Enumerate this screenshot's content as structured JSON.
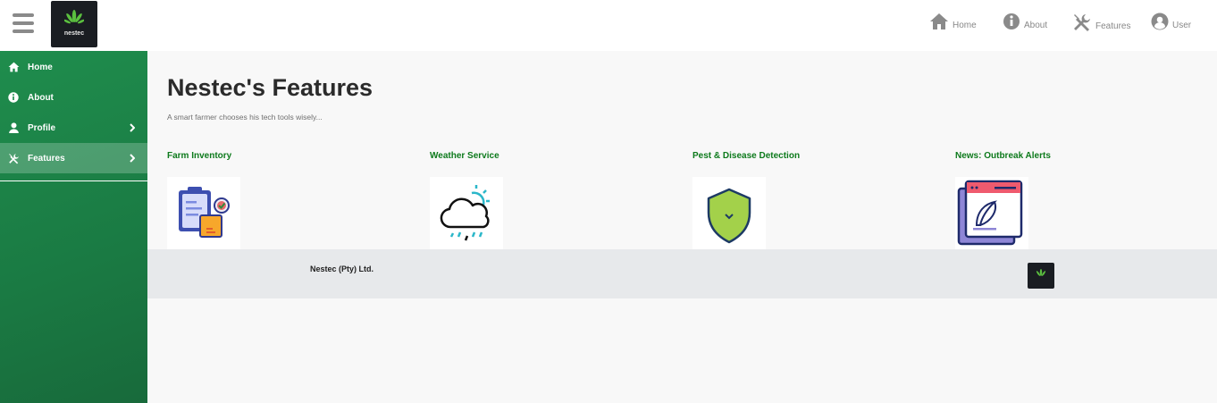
{
  "brand": {
    "logo_text": "nestec"
  },
  "topnav": [
    {
      "label": "Home",
      "icon": "home-icon"
    },
    {
      "label": "About",
      "icon": "info-icon"
    },
    {
      "label": "Features",
      "icon": "tools-icon"
    },
    {
      "label": "User",
      "icon": "user-circle-icon"
    }
  ],
  "sidebar": {
    "items": [
      {
        "label": "Home",
        "icon": "home-icon"
      },
      {
        "label": "About",
        "icon": "info-icon"
      },
      {
        "label": "Profile",
        "icon": "user-icon"
      },
      {
        "label": "Features",
        "icon": "tools-icon"
      }
    ]
  },
  "main": {
    "title": "Nestec's Features",
    "subtitle": "A smart farmer chooses his tech tools wisely...",
    "features": [
      {
        "title": "Farm Inventory",
        "icon": "clipboard-inventory-icon"
      },
      {
        "title": "Weather Service",
        "icon": "cloud-rain-icon"
      },
      {
        "title": "Pest & Disease Detection",
        "icon": "shield-icon"
      },
      {
        "title": "News: Outbreak Alerts",
        "icon": "news-feather-icon"
      }
    ]
  },
  "footer": {
    "text": "Nestec (Pty) Ltd."
  },
  "colors": {
    "sidebar": "#1f8d4d",
    "feature_title": "#0d7a1c",
    "footer_bg": "#e7e9eb"
  }
}
